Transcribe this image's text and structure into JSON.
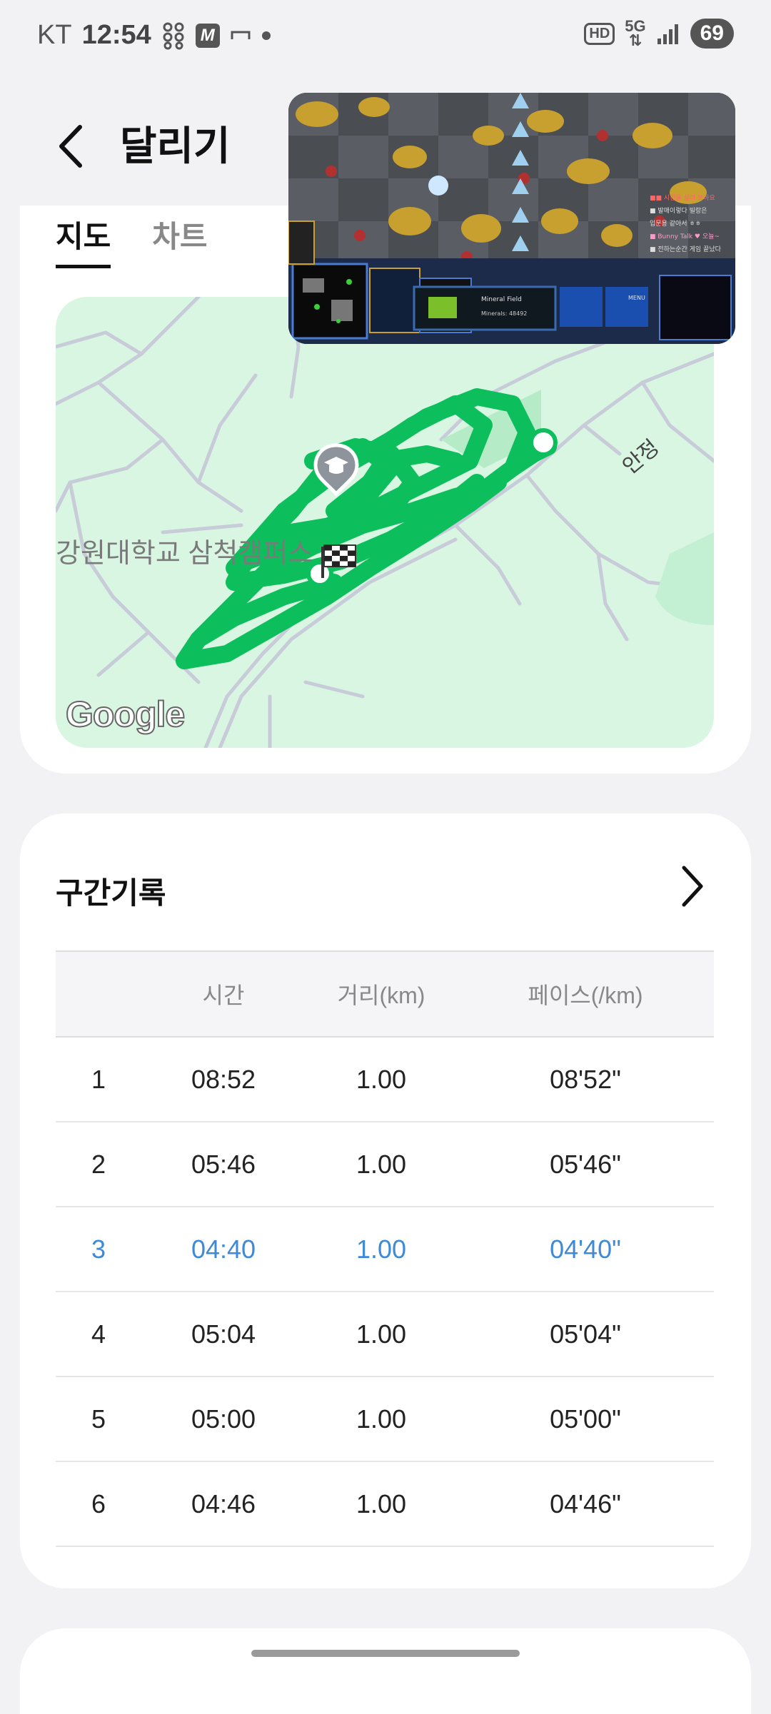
{
  "status_bar": {
    "carrier": "KT",
    "time": "12:54",
    "m_badge": "M",
    "hd_badge": "HD",
    "network_5g": "5G",
    "battery": "69"
  },
  "header": {
    "title": "달리기"
  },
  "tabs": [
    {
      "label": "지도",
      "active": true
    },
    {
      "label": "차트",
      "active": false
    }
  ],
  "map": {
    "campus_label": "강원대학교 삼척캠퍼스",
    "road_label": "안정",
    "google_logo": "Google",
    "route_color": "#0dbf5c",
    "background_color": "#d9f6e3"
  },
  "pip": {
    "panel_title": "Mineral Field",
    "panel_sub": "Minerals: 48492",
    "menu": "MENU"
  },
  "laps": {
    "title": "구간기록",
    "columns": [
      "",
      "시간",
      "거리(km)",
      "페이스(/km)"
    ],
    "rows": [
      {
        "no": "1",
        "time": "08:52",
        "distance": "1.00",
        "pace": "08'52\""
      },
      {
        "no": "2",
        "time": "05:46",
        "distance": "1.00",
        "pace": "05'46\""
      },
      {
        "no": "3",
        "time": "04:40",
        "distance": "1.00",
        "pace": "04'40\"",
        "highlight": true
      },
      {
        "no": "4",
        "time": "05:04",
        "distance": "1.00",
        "pace": "05'04\""
      },
      {
        "no": "5",
        "time": "05:00",
        "distance": "1.00",
        "pace": "05'00\""
      },
      {
        "no": "6",
        "time": "04:46",
        "distance": "1.00",
        "pace": "04'46\""
      }
    ],
    "highlight_color": "#3f8ad6"
  }
}
